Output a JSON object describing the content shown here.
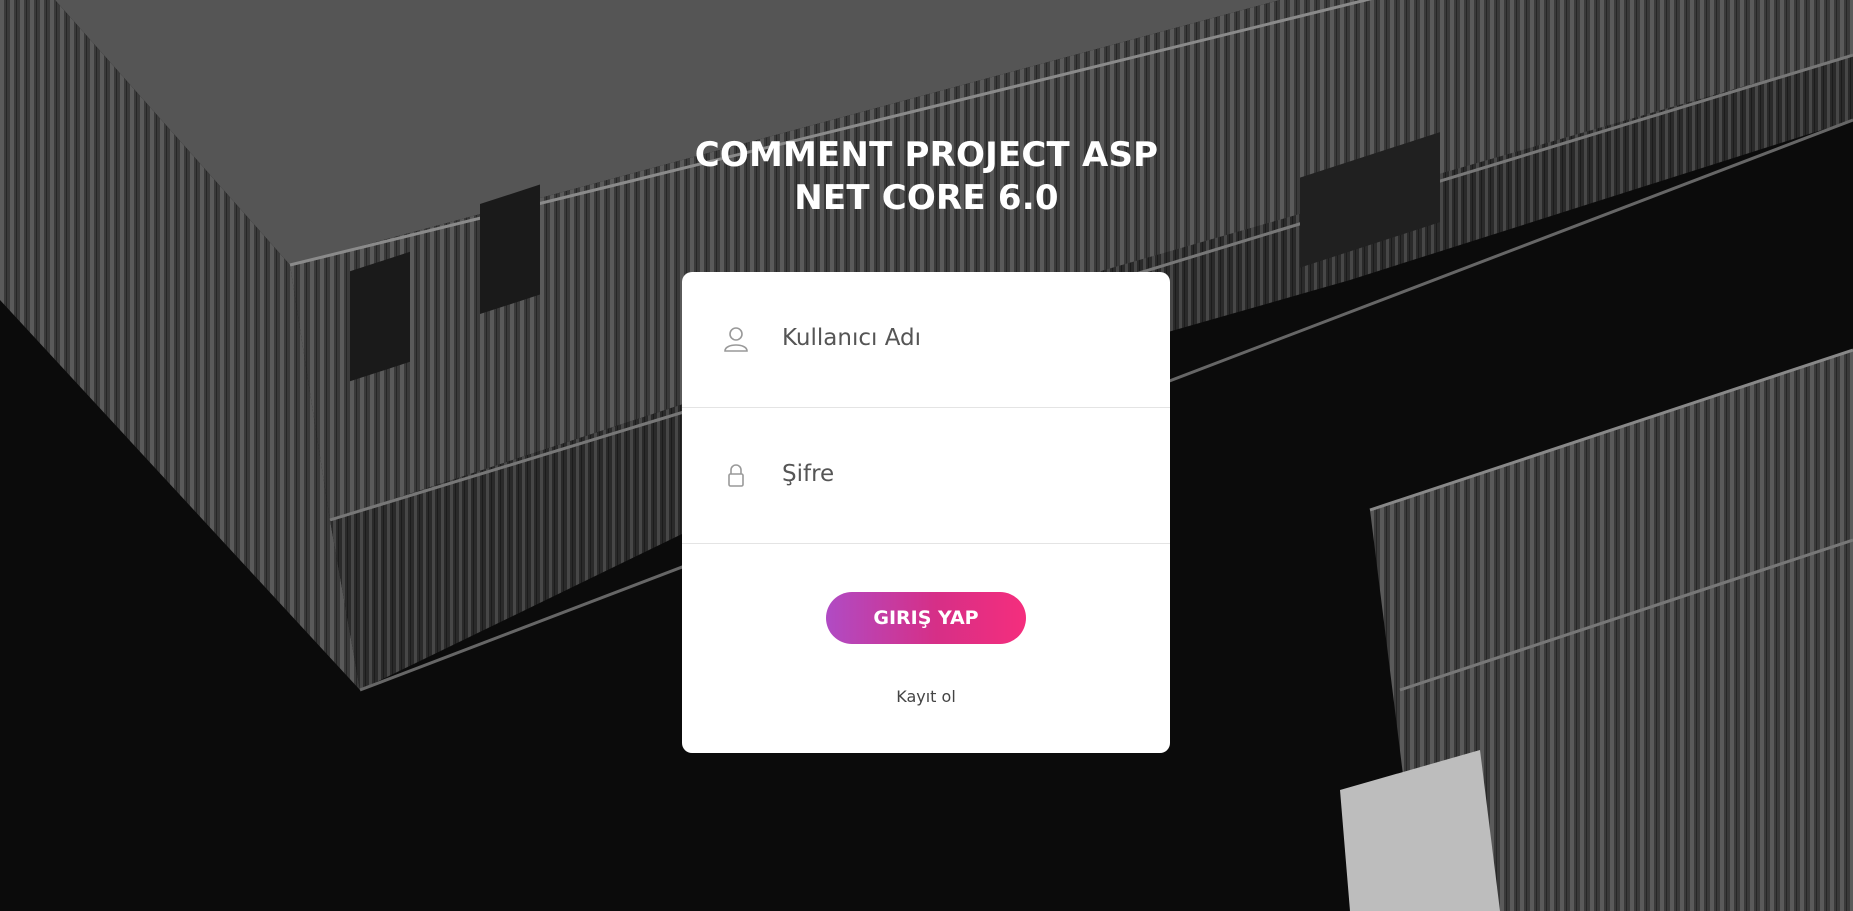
{
  "app": {
    "title_line1": "COMMENT PROJECT ASP",
    "title_line2": "NET CORE 6.0"
  },
  "form": {
    "username": {
      "placeholder": "Kullanıcı Adı",
      "value": "",
      "icon": "user-icon"
    },
    "password": {
      "placeholder": "Şifre",
      "value": "",
      "icon": "lock-icon"
    },
    "submit_label": "GIRIŞ YAP",
    "register_link": "Kayıt ol"
  },
  "colors": {
    "button_gradient_start": "#b04bc4",
    "button_gradient_end": "#f52e7d",
    "card_background": "#ffffff",
    "page_background": "#0b0b0b"
  }
}
